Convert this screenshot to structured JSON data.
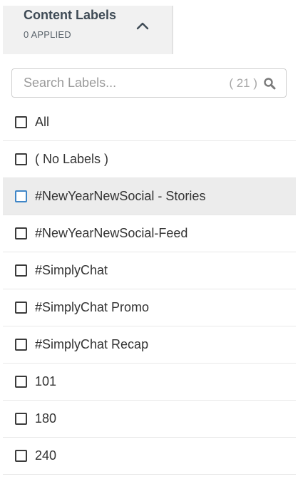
{
  "header": {
    "title": "Content Labels",
    "applied_text": "0 APPLIED",
    "toggle_icon": "chevron-up-icon"
  },
  "search": {
    "placeholder": "Search Labels...",
    "value": "",
    "count_text": "( 21 )",
    "icon": "search-icon"
  },
  "labels": [
    {
      "label": "All",
      "checked": false
    },
    {
      "label": "( No Labels )",
      "checked": false
    },
    {
      "label": "#NewYearNewSocial - Stories",
      "checked": false,
      "highlighted": true
    },
    {
      "label": "#NewYearNewSocial-Feed",
      "checked": false
    },
    {
      "label": "#SimplyChat",
      "checked": false
    },
    {
      "label": "#SimplyChat Promo",
      "checked": false
    },
    {
      "label": "#SimplyChat Recap",
      "checked": false
    },
    {
      "label": "101",
      "checked": false
    },
    {
      "label": "180",
      "checked": false
    },
    {
      "label": "240",
      "checked": false
    }
  ],
  "colors": {
    "header_bg": "#f1f1f1",
    "highlight_bg": "#ececec",
    "highlight_checkbox": "#3f86c7",
    "text": "#333333"
  }
}
